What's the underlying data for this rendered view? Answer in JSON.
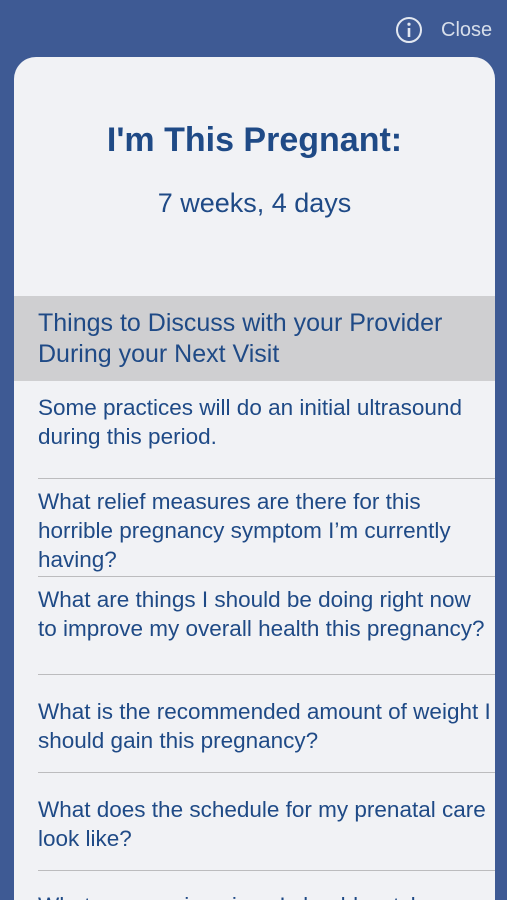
{
  "topbar": {
    "close_label": "Close",
    "info_icon": "info-circle-icon"
  },
  "card": {
    "title": "I'm This Pregnant:",
    "subtitle": "7 weeks, 4 days"
  },
  "section": {
    "header": "Things to Discuss with your Provider During your Next Visit"
  },
  "items": [
    "Some practices will do an initial ultrasound during this period.",
    "What relief measures are there for this horrible pregnancy symptom I’m currently having?",
    "What are things I should be doing right now to improve my overall health this pregnancy?",
    "What is the recommended amount of weight I should gain this pregnancy?",
    "What does the schedule for my prenatal care look like?",
    "What are warning signs I should watch"
  ],
  "colors": {
    "background": "#3e5a94",
    "text_accent": "#1f4a86",
    "card": "#f1f2f5",
    "section_header_bg": "#cfcfd1"
  }
}
